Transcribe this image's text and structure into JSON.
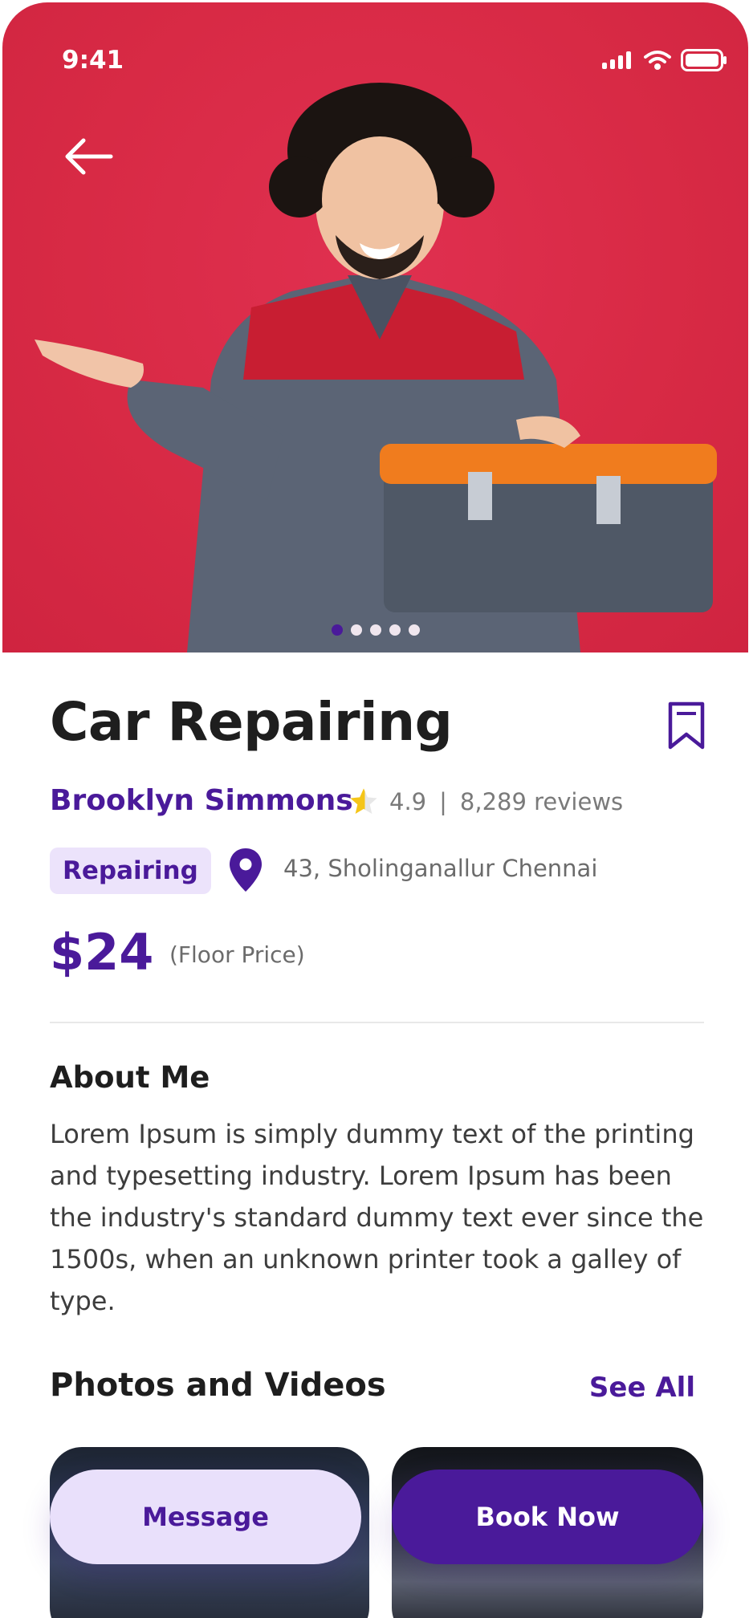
{
  "status_bar": {
    "time": "9:41"
  },
  "service": {
    "title": "Car Repairing",
    "provider": "Brooklyn Simmons",
    "rating": "4.9",
    "separator": "|",
    "reviews": "8,289 reviews",
    "category_tag": "Repairing",
    "location": "43, Sholinganallur Chennai",
    "price": "$24",
    "price_note": "(Floor Price)"
  },
  "about": {
    "title": "About Me",
    "text": "Lorem Ipsum is simply dummy text of the printing and typesetting industry. Lorem Ipsum has been the industry's standard dummy text ever since the 1500s, when an unknown printer took a galley of type."
  },
  "media_section": {
    "title": "Photos and Videos",
    "see_all": "See All"
  },
  "actions": {
    "message": "Message",
    "book_now": "Book Now"
  },
  "carousel": {
    "count": 5,
    "active_index": 0
  },
  "colors": {
    "primary": "#4a1a9a",
    "hero_bg": "#d82a45",
    "tag_bg": "#ece3fb",
    "star": "#f5c518"
  },
  "icons": [
    "back-arrow-icon",
    "signal-icon",
    "wifi-icon",
    "battery-icon",
    "bookmark-icon",
    "star-icon",
    "location-pin-icon"
  ]
}
